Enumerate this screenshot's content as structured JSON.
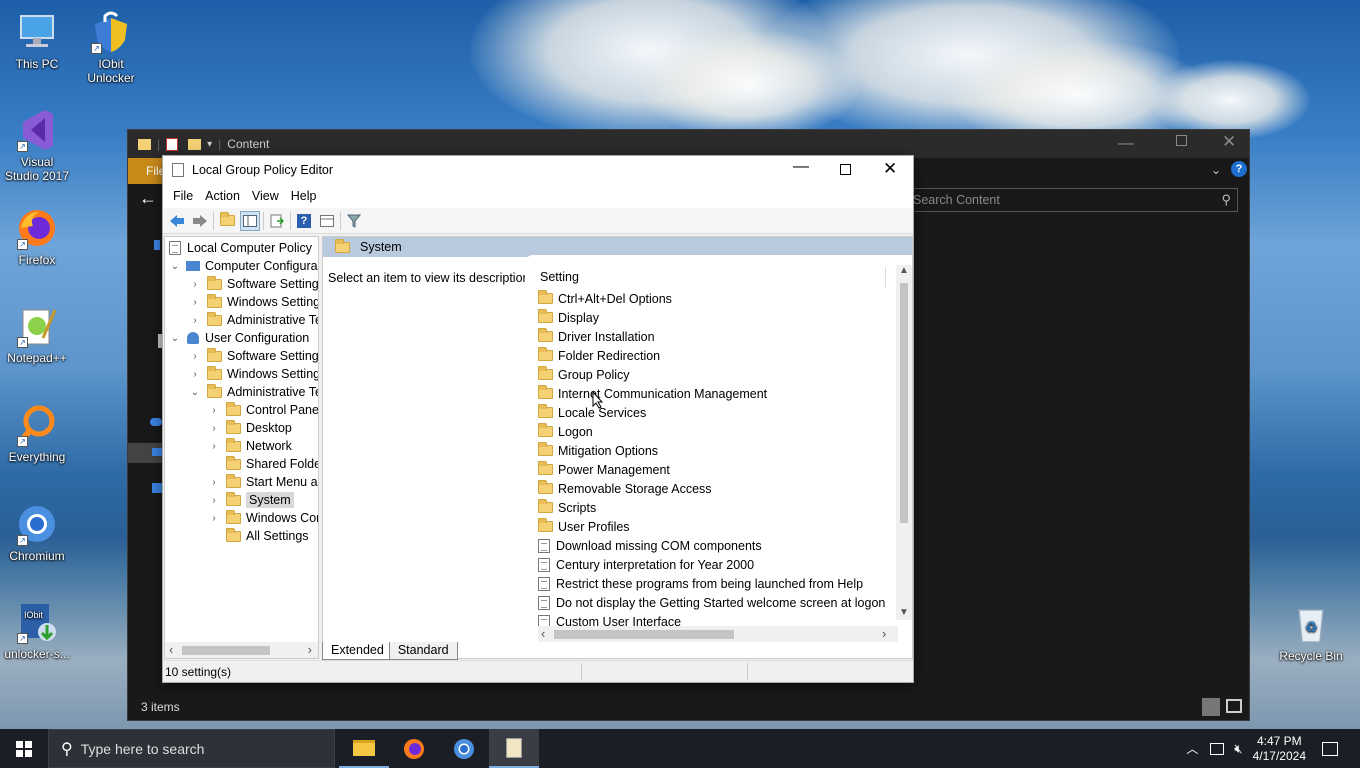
{
  "desktop": {
    "icons": [
      {
        "label": "This PC"
      },
      {
        "label": "IObit Unlocker"
      },
      {
        "label": "Visual Studio 2017"
      },
      {
        "label": "Firefox"
      },
      {
        "label": "Notepad++"
      },
      {
        "label": "Everything"
      },
      {
        "label": "Chromium"
      },
      {
        "label": "unlocker-s..."
      },
      {
        "label": "Recycle Bin"
      }
    ]
  },
  "explorer": {
    "title": "Content",
    "ribbon_file": "File",
    "search_placeholder": "Search Content",
    "status": "3 items"
  },
  "gpedit": {
    "title": "Local Group Policy Editor",
    "menu": [
      "File",
      "Action",
      "View",
      "Help"
    ],
    "tree": [
      {
        "label": "Local Computer Policy"
      },
      {
        "label": "Computer Configura"
      },
      {
        "label": "Software Settings"
      },
      {
        "label": "Windows Setting"
      },
      {
        "label": "Administrative Te"
      },
      {
        "label": "User Configuration"
      },
      {
        "label": "Software Settings"
      },
      {
        "label": "Windows Setting"
      },
      {
        "label": "Administrative Te"
      },
      {
        "label": "Control Panel"
      },
      {
        "label": "Desktop"
      },
      {
        "label": "Network"
      },
      {
        "label": "Shared Folder"
      },
      {
        "label": "Start Menu ar"
      },
      {
        "label": "System"
      },
      {
        "label": "Windows Cor"
      },
      {
        "label": "All Settings"
      }
    ],
    "header": "System",
    "description": "Select an item to view its description.",
    "column": "Setting",
    "settings": [
      "Ctrl+Alt+Del Options",
      "Display",
      "Driver Installation",
      "Folder Redirection",
      "Group Policy",
      "Internet Communication Management",
      "Locale Services",
      "Logon",
      "Mitigation Options",
      "Power Management",
      "Removable Storage Access",
      "Scripts",
      "User Profiles",
      "Download missing COM components",
      "Century interpretation for Year 2000",
      "Restrict these programs from being launched from Help",
      "Do not display the Getting Started welcome screen at logon",
      "Custom User Interface"
    ],
    "tabs": [
      "Extended",
      "Standard"
    ],
    "status": "10 setting(s)"
  },
  "taskbar": {
    "search_placeholder": "Type here to search",
    "time": "4:47 PM",
    "date": "4/17/2024"
  }
}
